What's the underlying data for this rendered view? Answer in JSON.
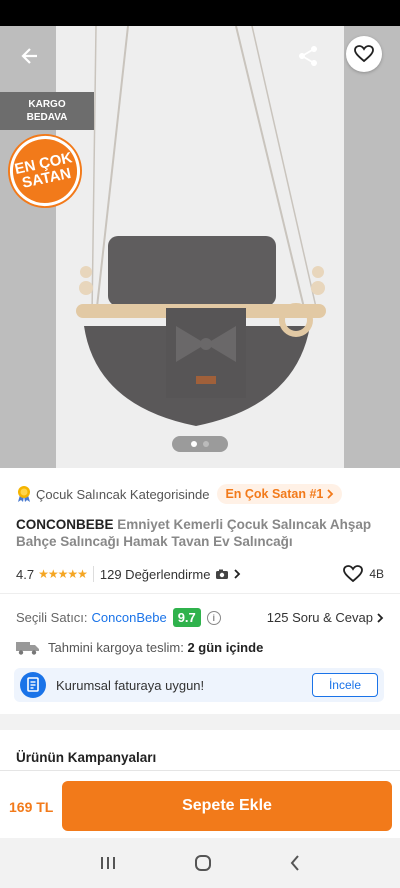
{
  "badges": {
    "free_shipping": "KARGO BEDAVA",
    "best_seller_line1": "EN ÇOK",
    "best_seller_line2": "SATAN"
  },
  "gallery": {
    "current_index": 1,
    "total": 2
  },
  "category": {
    "label": "Çocuk Salıncak Kategorisinde",
    "rank_badge": "En Çok Satan #1"
  },
  "product": {
    "brand": "CONCONBEBE",
    "name": "Emniyet Kemerli Çocuk Salıncak Ahşap Bahçe Salıncağı Hamak Tavan Ev Salıncağı"
  },
  "rating": {
    "score": "4.7",
    "stars": "★★★★★",
    "reviews": "129 Değerlendirme",
    "favorites": "4B"
  },
  "seller": {
    "label": "Seçili Satıcı:",
    "name": "ConconBebe",
    "score": "9.7",
    "qa": "125 Soru & Cevap"
  },
  "delivery": {
    "label": "Tahmini kargoya teslim:",
    "value": "2 gün içinde"
  },
  "invoice": {
    "text": "Kurumsal faturaya uygun!",
    "button": "İncele"
  },
  "campaign": {
    "title": "Ürünün Kampanyaları"
  },
  "cart": {
    "price": "169 TL",
    "button": "Sepete Ekle"
  },
  "colors": {
    "brand_orange": "#f27a1a",
    "seller_blue": "#1a73e8",
    "score_green": "#2fb24c"
  }
}
